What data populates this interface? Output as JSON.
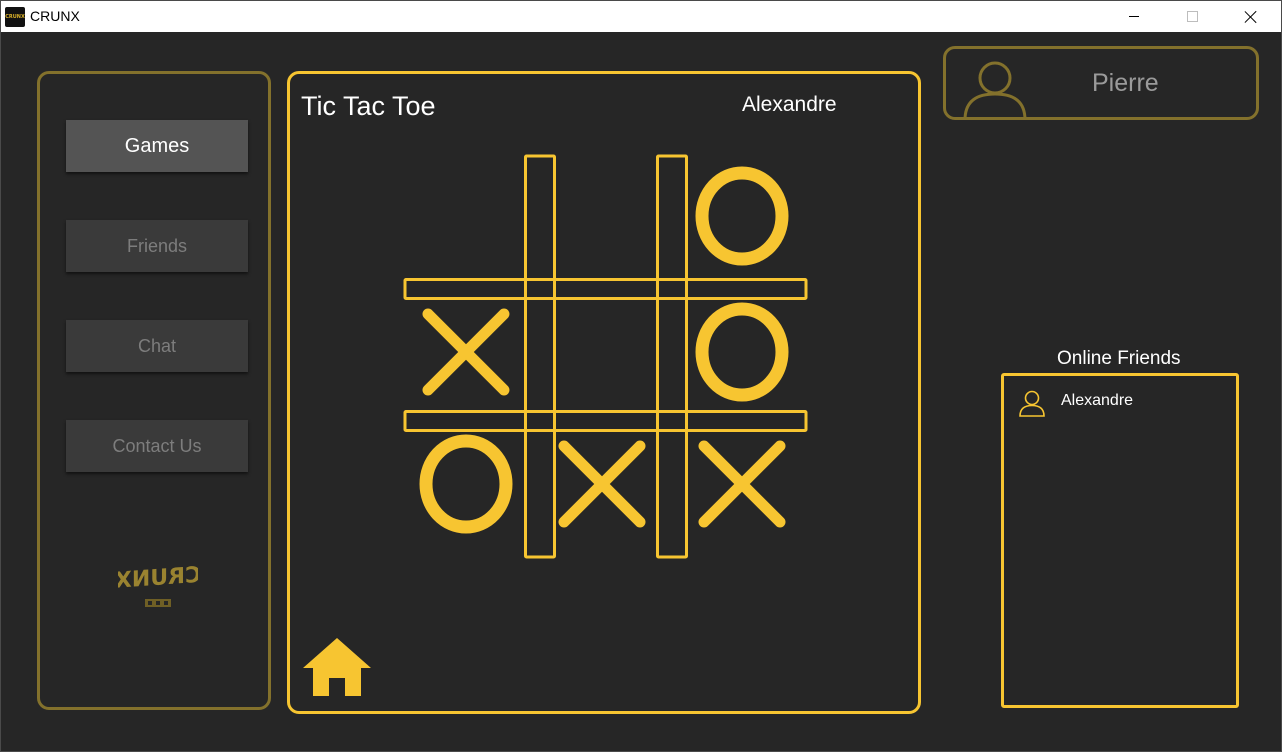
{
  "window": {
    "title": "CRUNX",
    "icon_text": "CRUNX"
  },
  "sidebar": {
    "items": [
      {
        "label": "Games",
        "active": true
      },
      {
        "label": "Friends",
        "active": false
      },
      {
        "label": "Chat",
        "active": false
      },
      {
        "label": "Contact Us",
        "active": false
      }
    ],
    "logo_text": "CRUNX"
  },
  "game": {
    "title": "Tic Tac Toe",
    "opponent": "Alexandre",
    "board": [
      [
        "",
        "",
        "O"
      ],
      [
        "X",
        "",
        "O"
      ],
      [
        "O",
        "X",
        "X"
      ]
    ],
    "home_icon": "home-icon"
  },
  "profile": {
    "name": "Pierre",
    "avatar_icon": "user-avatar-icon"
  },
  "online_friends": {
    "title": "Online Friends",
    "items": [
      {
        "name": "Alexandre",
        "icon": "user-icon"
      }
    ]
  },
  "colors": {
    "background": "#262626",
    "accent": "#f7c531",
    "muted_accent": "#83712c",
    "button": "#3a3a3a",
    "button_active": "#545454"
  }
}
